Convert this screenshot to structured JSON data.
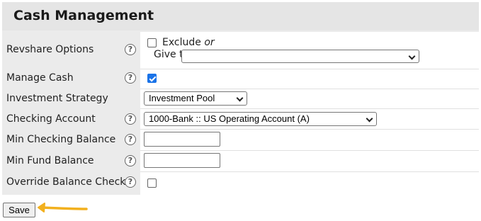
{
  "panel": {
    "title": "Cash Management"
  },
  "help_glyph": "?",
  "rows": {
    "revshare": {
      "label": "Revshare Options",
      "exclude_label": "Exclude",
      "or_text": "or",
      "give_to_label": "Give to",
      "exclude_checked": false,
      "give_to_value": ""
    },
    "manage_cash": {
      "label": "Manage Cash",
      "checked": true
    },
    "investment_strategy": {
      "label": "Investment Strategy",
      "value": "Investment Pool"
    },
    "checking_account": {
      "label": "Checking Account",
      "value": "1000-Bank :: US Operating Account (A)"
    },
    "min_checking_balance": {
      "label": "Min Checking Balance",
      "value": ""
    },
    "min_fund_balance": {
      "label": "Min Fund Balance",
      "value": ""
    },
    "override_balance_check": {
      "label": "Override Balance Check",
      "checked": false
    }
  },
  "actions": {
    "save_label": "Save"
  },
  "colors": {
    "checkbox_checked": "#1a73e8",
    "arrow": "#f2b01e",
    "label_bg": "#ebebeb"
  }
}
